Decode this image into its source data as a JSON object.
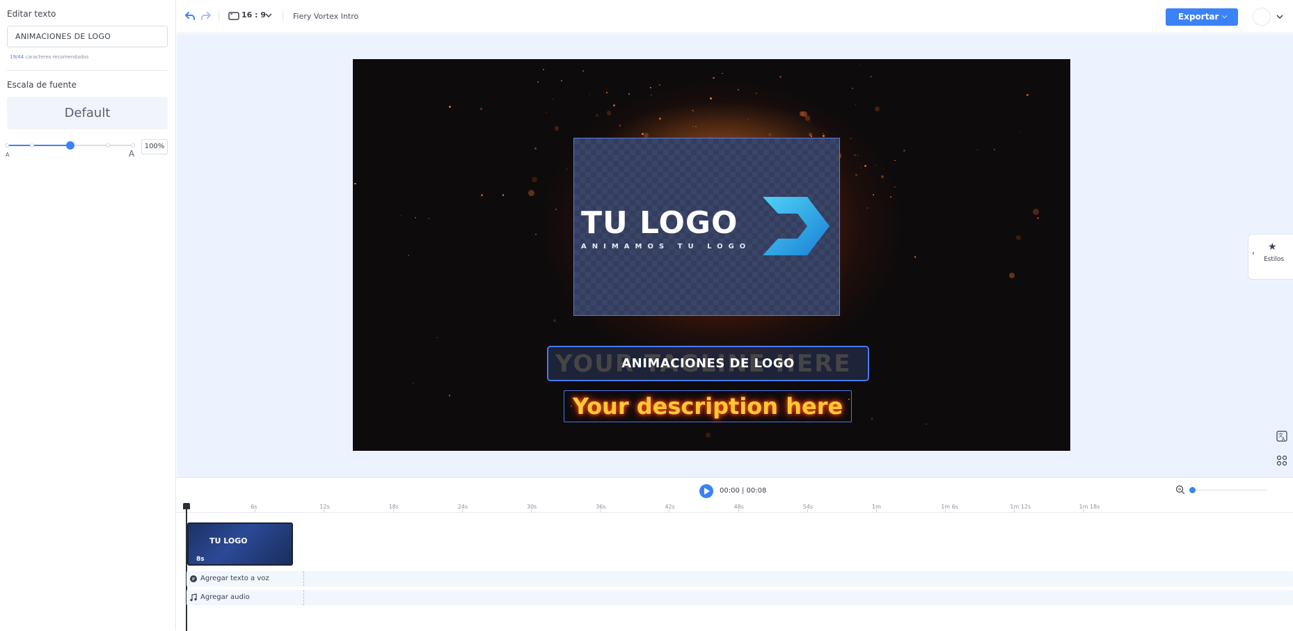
{
  "left_panel": {
    "edit_text_label": "Editar texto",
    "text_value": "ANIMACIONES DE LOGO",
    "char_count": "19/44",
    "char_hint": "caracteres recomendados",
    "font_scale_label": "Escala de fuente",
    "font_scale_value": "Default",
    "slider_small_label": "A",
    "slider_large_label": "A",
    "scale_percent": "100%",
    "scale_level": 0.5
  },
  "topbar": {
    "aspect_ratio": "16 : 9",
    "project_name": "Fiery Vortex Intro",
    "export_label": "Exportar",
    "icons": [
      "undo-icon",
      "redo-icon",
      "aspect-ratio-icon",
      "chevron-down-icon",
      "avatar"
    ]
  },
  "canvas": {
    "logo_text": "TU LOGO",
    "logo_subtitle": "ANIMAMOS TU LOGO",
    "tagline_ghost": "YOUR TAGLINE HERE",
    "tagline": "ANIMACIONES DE LOGO",
    "description": "Your description here"
  },
  "side": {
    "styles_label": "Estilos",
    "icons": [
      "star-icon",
      "translate-icon",
      "grid-icon",
      "assistant-icon"
    ]
  },
  "timeline": {
    "time_current": "00:00",
    "time_total": "00:08",
    "time_display": "00:00 | 00:08",
    "ruler_labels": [
      "6s",
      "12s",
      "18s",
      "24s",
      "30s",
      "36s",
      "42s",
      "48s",
      "54s",
      "1m",
      "1m 6s",
      "1m 12s",
      "1m 18s"
    ],
    "clip_logo": "TU LOGO",
    "clip_duration": "8s",
    "tts_label": "Agregar texto a voz",
    "audio_label": "Agregar audio"
  },
  "colors": {
    "accent": "#3b82f6",
    "workspace_bg": "#edf3fe",
    "description_text": "#ffc93a"
  }
}
